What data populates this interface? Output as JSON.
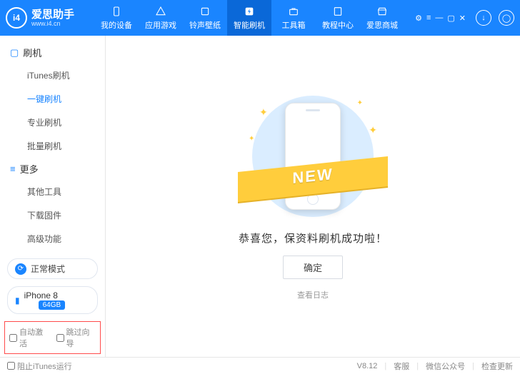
{
  "header": {
    "logo_mark": "i4",
    "logo_title": "爱思助手",
    "logo_sub": "www.i4.cn",
    "nav": [
      {
        "label": "我的设备",
        "icon": "phone-icon"
      },
      {
        "label": "应用游戏",
        "icon": "apps-icon"
      },
      {
        "label": "铃声壁纸",
        "icon": "music-icon"
      },
      {
        "label": "智能刷机",
        "icon": "flash-icon",
        "active": true
      },
      {
        "label": "工具箱",
        "icon": "toolbox-icon"
      },
      {
        "label": "教程中心",
        "icon": "book-icon"
      },
      {
        "label": "爱思商城",
        "icon": "shop-icon"
      }
    ],
    "window_controls": [
      "⚙",
      "≡",
      "—",
      "▢",
      "✕"
    ]
  },
  "sidebar": {
    "group1": {
      "icon": "▢",
      "title": "刷机",
      "items": [
        "iTunes刷机",
        "一键刷机",
        "专业刷机",
        "批量刷机"
      ],
      "activeIndex": 1
    },
    "group2": {
      "icon": "≡",
      "title": "更多",
      "items": [
        "其他工具",
        "下载固件",
        "高级功能"
      ]
    },
    "mode_label": "正常模式",
    "device_name": "iPhone 8",
    "device_storage": "64GB",
    "check_auto": "自动激活",
    "check_skip": "跳过向导"
  },
  "main": {
    "ribbon_text": "NEW",
    "message": "恭喜您，保资料刷机成功啦！",
    "ok_button": "确定",
    "log_link": "查看日志"
  },
  "status": {
    "prevent_itunes": "阻止iTunes运行",
    "version": "V8.12",
    "links": [
      "客服",
      "微信公众号",
      "检查更新"
    ]
  }
}
